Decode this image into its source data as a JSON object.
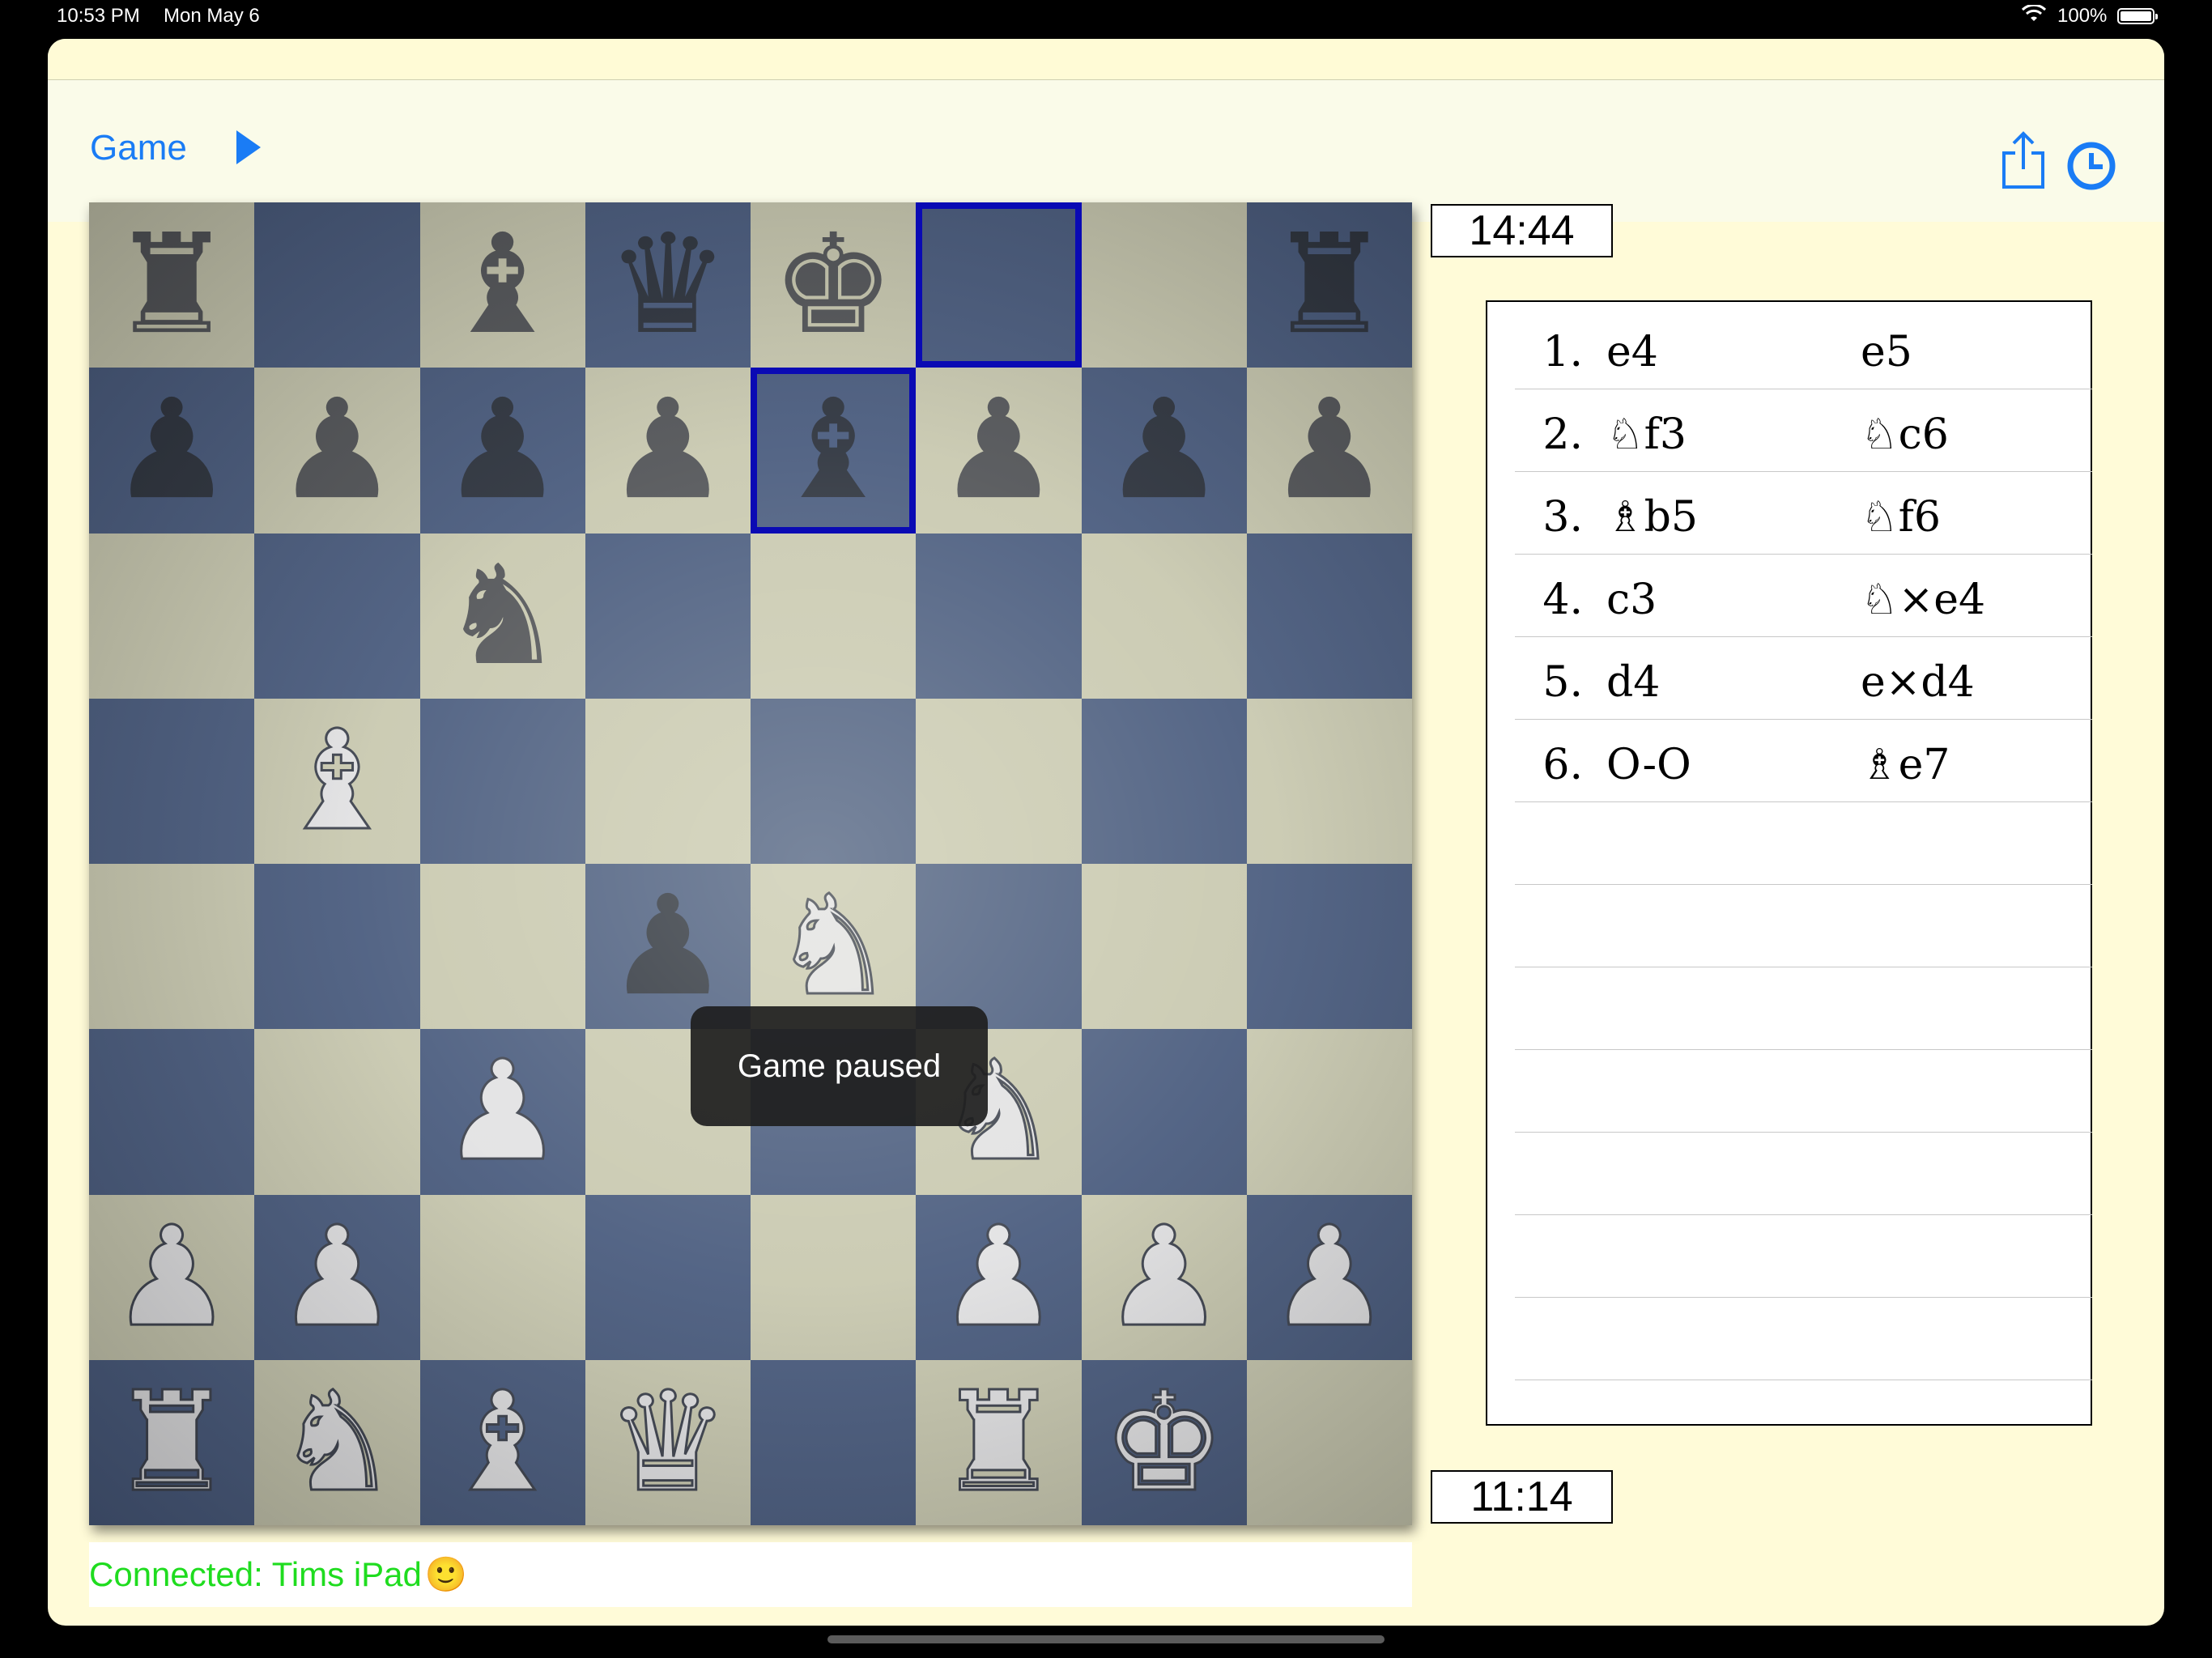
{
  "status_bar": {
    "time": "10:53 PM",
    "date": "Mon May 6",
    "battery": "100%"
  },
  "nav": {
    "game_label": "Game",
    "play_icon": "play-icon",
    "share_icon": "share-icon",
    "clock_icon": "clock-icon"
  },
  "colors": {
    "accent": "#1a7cf5",
    "light_square": "#c9c9b1",
    "dark_square": "#4b5d80",
    "highlight": "#0a0ab4",
    "connected": "#1fdc1f"
  },
  "board": {
    "ranks": [
      [
        "r",
        "",
        "b",
        "q",
        "k",
        "",
        "",
        "r"
      ],
      [
        "p",
        "p",
        "p",
        "p",
        "b",
        "p",
        "p",
        "p"
      ],
      [
        "",
        "",
        "n",
        "",
        "",
        "",
        "",
        ""
      ],
      [
        "",
        "B",
        "",
        "",
        "",
        "",
        "",
        ""
      ],
      [
        "",
        "",
        "",
        "p",
        "N",
        "",
        "",
        ""
      ],
      [
        "",
        "",
        "P",
        "",
        "",
        "N",
        "",
        ""
      ],
      [
        "P",
        "P",
        "",
        "",
        "",
        "P",
        "P",
        "P"
      ],
      [
        "R",
        "N",
        "B",
        "Q",
        "",
        "R",
        "K",
        ""
      ]
    ],
    "highlighted_squares": [
      "e7",
      "f8"
    ]
  },
  "toast": "Game paused",
  "clocks": {
    "top": "14:44",
    "bottom": "11:14"
  },
  "moves": [
    {
      "num": "1.",
      "white": "e4",
      "black": "e5"
    },
    {
      "num": "2.",
      "white": "♘f3",
      "black": "♘c6"
    },
    {
      "num": "3.",
      "white": "♗b5",
      "black": "♘f6"
    },
    {
      "num": "4.",
      "white": "c3",
      "black": "♘×e4"
    },
    {
      "num": "5.",
      "white": "d4",
      "black": "e×d4"
    },
    {
      "num": "6.",
      "white": "O-O",
      "black": "♗e7"
    }
  ],
  "connection": {
    "text": "Connected: Tims iPad",
    "emoji": "🙂"
  }
}
